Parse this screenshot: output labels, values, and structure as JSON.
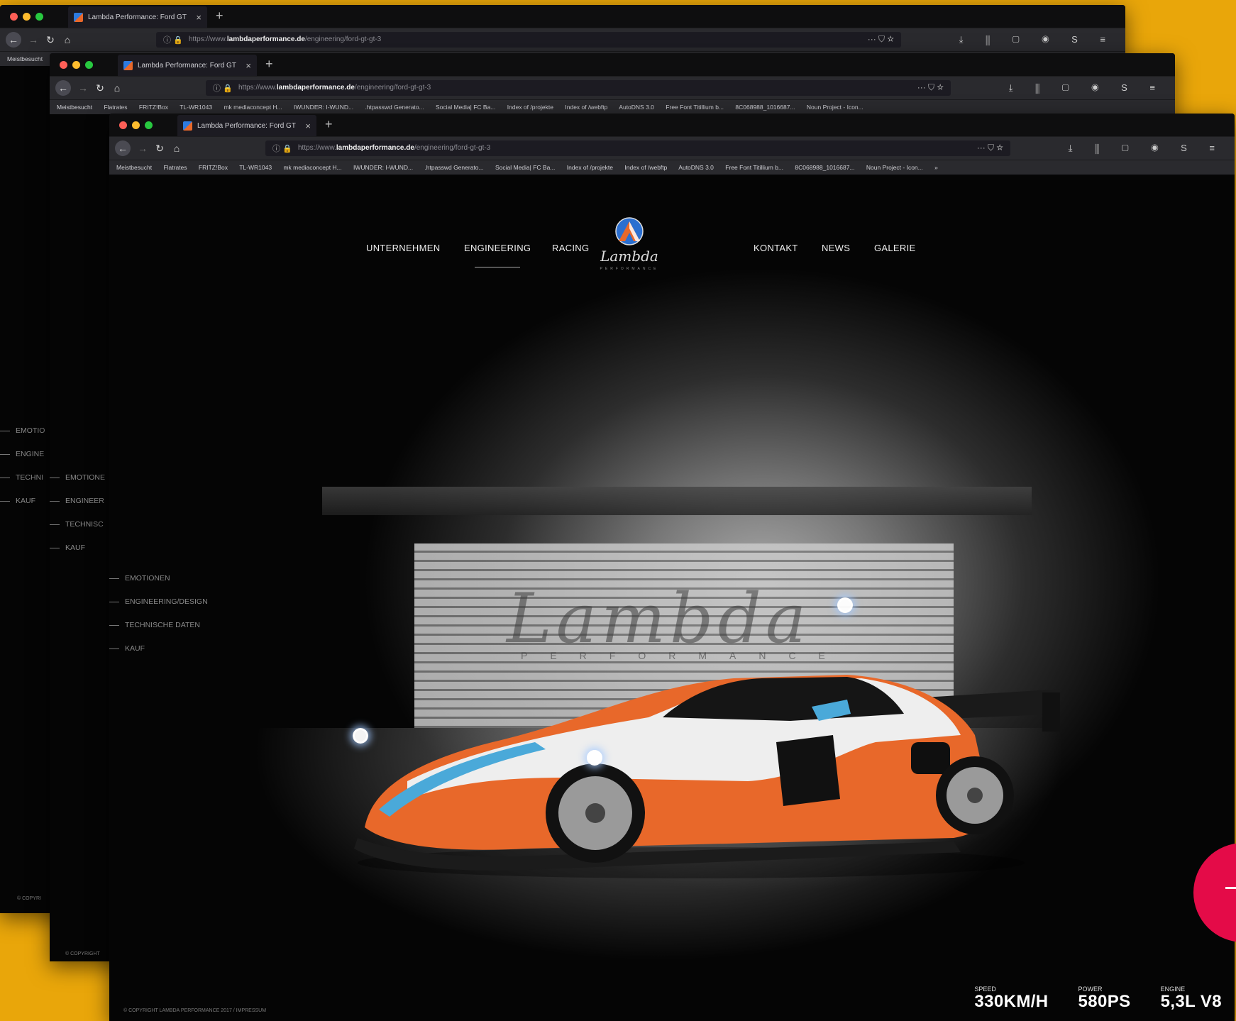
{
  "browser": {
    "tab_title": "Lambda Performance: Ford GT",
    "tab_close": "×",
    "new_tab": "+",
    "url_prefix": "https://www.",
    "url_domain": "lambdaperformance.de",
    "url_path": "/engineering/ford-gt-gt-3",
    "url_tools": "··· ⛉ ☆",
    "toolbar_icons": "⤓ ⫼ ▢ ◉ S ≡",
    "bookmarks": [
      "Meistbesucht",
      "Flatrates",
      "FRITZ!Box",
      "TL-WR1043",
      "mk mediaconcept H...",
      "IWUNDER: I-WUND...",
      ".htpasswd Generato...",
      "Social Media| FC Ba...",
      "Index of /projekte",
      "Index of /webftp",
      "AutoDNS 3.0",
      "Free Font Titillium b...",
      "8C068988_1016687...",
      "Noun Project - Icon..."
    ],
    "bookmarks_overflow": "»"
  },
  "site": {
    "nav_left": [
      "UNTERNEHMEN",
      "ENGINEERING",
      "RACING"
    ],
    "nav_right": [
      "KONTAKT",
      "NEWS",
      "GALERIE"
    ],
    "active_nav": "ENGINEERING",
    "side_menu": [
      "EMOTIONEN",
      "ENGINEERING/DESIGN",
      "TECHNISCHE DATEN",
      "KAUF"
    ],
    "side_menu_win1": [
      "EMOTIO",
      "ENGINE",
      "TECHNI",
      "KAUF"
    ],
    "side_menu_win2": [
      "EMOTIONE",
      "ENGINEER",
      "TECHNISC",
      "KAUF"
    ],
    "copyright": "© COPYRIGHT LAMBDA PERFORMANCE 2017 / IMPRESSUM",
    "copyright_win1": "© COPYRI",
    "copyright_win2": "© COPYRIGHT",
    "specs": [
      {
        "label": "SPEED",
        "value": "330KM/H"
      },
      {
        "label": "POWER",
        "value": "580PS"
      },
      {
        "label": "ENGINE",
        "value": "5,3L V8"
      }
    ]
  },
  "colors": {
    "background": "#E9A60A",
    "fab": "#e40b48",
    "car_orange": "#e8682a",
    "car_blue": "#4aa9d9"
  },
  "icons": {
    "back": "arrow-left-icon",
    "forward": "arrow-right-icon",
    "reload": "reload-icon",
    "home": "home-icon",
    "lock": "lock-icon",
    "fab": "minus-icon"
  }
}
